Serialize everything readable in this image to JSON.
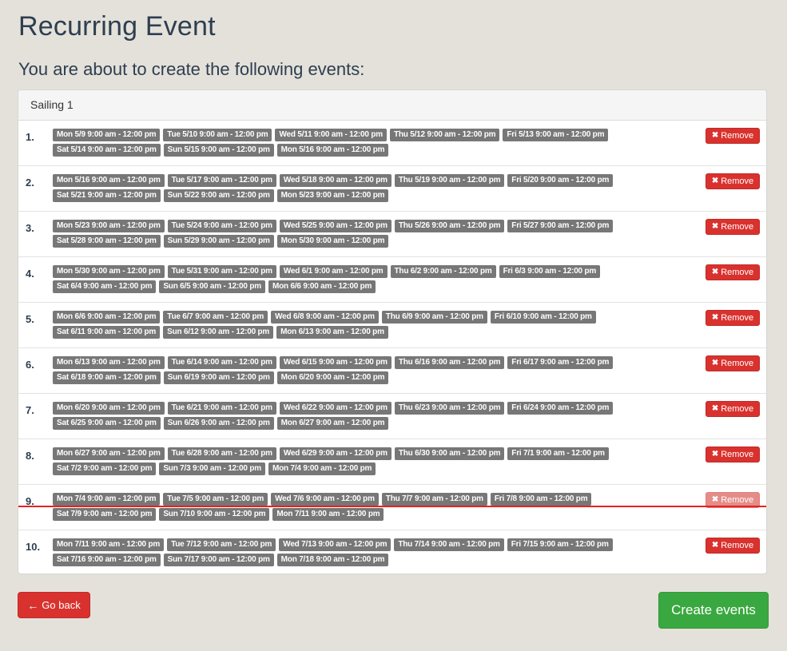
{
  "title": "Recurring Event",
  "subtitle": "You are about to create the following events:",
  "panel": {
    "heading": "Sailing 1"
  },
  "remove_label": "Remove",
  "go_back_label": "Go back",
  "create_label": "Create events",
  "icons": {
    "remove": "close-icon",
    "back": "arrow-left-icon"
  },
  "colors": {
    "tag": "#777777",
    "danger": "#d9322e",
    "success": "#3aa840",
    "highlight_line": "#e8211e"
  },
  "rows": [
    {
      "number": "1.",
      "events": [
        "Mon 5/9 9:00 am - 12:00 pm",
        "Tue 5/10 9:00 am - 12:00 pm",
        "Wed 5/11 9:00 am - 12:00 pm",
        "Thu 5/12 9:00 am - 12:00 pm",
        "Fri 5/13 9:00 am - 12:00 pm",
        "Sat 5/14 9:00 am - 12:00 pm",
        "Sun 5/15 9:00 am - 12:00 pm",
        "Mon 5/16 9:00 am - 12:00 pm"
      ]
    },
    {
      "number": "2.",
      "events": [
        "Mon 5/16 9:00 am - 12:00 pm",
        "Tue 5/17 9:00 am - 12:00 pm",
        "Wed 5/18 9:00 am - 12:00 pm",
        "Thu 5/19 9:00 am - 12:00 pm",
        "Fri 5/20 9:00 am - 12:00 pm",
        "Sat 5/21 9:00 am - 12:00 pm",
        "Sun 5/22 9:00 am - 12:00 pm",
        "Mon 5/23 9:00 am - 12:00 pm"
      ]
    },
    {
      "number": "3.",
      "events": [
        "Mon 5/23 9:00 am - 12:00 pm",
        "Tue 5/24 9:00 am - 12:00 pm",
        "Wed 5/25 9:00 am - 12:00 pm",
        "Thu 5/26 9:00 am - 12:00 pm",
        "Fri 5/27 9:00 am - 12:00 pm",
        "Sat 5/28 9:00 am - 12:00 pm",
        "Sun 5/29 9:00 am - 12:00 pm",
        "Mon 5/30 9:00 am - 12:00 pm"
      ]
    },
    {
      "number": "4.",
      "events": [
        "Mon 5/30 9:00 am - 12:00 pm",
        "Tue 5/31 9:00 am - 12:00 pm",
        "Wed 6/1 9:00 am - 12:00 pm",
        "Thu 6/2 9:00 am - 12:00 pm",
        "Fri 6/3 9:00 am - 12:00 pm",
        "Sat 6/4 9:00 am - 12:00 pm",
        "Sun 6/5 9:00 am - 12:00 pm",
        "Mon 6/6 9:00 am - 12:00 pm"
      ]
    },
    {
      "number": "5.",
      "events": [
        "Mon 6/6 9:00 am - 12:00 pm",
        "Tue 6/7 9:00 am - 12:00 pm",
        "Wed 6/8 9:00 am - 12:00 pm",
        "Thu 6/9 9:00 am - 12:00 pm",
        "Fri 6/10 9:00 am - 12:00 pm",
        "Sat 6/11 9:00 am - 12:00 pm",
        "Sun 6/12 9:00 am - 12:00 pm",
        "Mon 6/13 9:00 am - 12:00 pm"
      ]
    },
    {
      "number": "6.",
      "events": [
        "Mon 6/13 9:00 am - 12:00 pm",
        "Tue 6/14 9:00 am - 12:00 pm",
        "Wed 6/15 9:00 am - 12:00 pm",
        "Thu 6/16 9:00 am - 12:00 pm",
        "Fri 6/17 9:00 am - 12:00 pm",
        "Sat 6/18 9:00 am - 12:00 pm",
        "Sun 6/19 9:00 am - 12:00 pm",
        "Mon 6/20 9:00 am - 12:00 pm"
      ]
    },
    {
      "number": "7.",
      "events": [
        "Mon 6/20 9:00 am - 12:00 pm",
        "Tue 6/21 9:00 am - 12:00 pm",
        "Wed 6/22 9:00 am - 12:00 pm",
        "Thu 6/23 9:00 am - 12:00 pm",
        "Fri 6/24 9:00 am - 12:00 pm",
        "Sat 6/25 9:00 am - 12:00 pm",
        "Sun 6/26 9:00 am - 12:00 pm",
        "Mon 6/27 9:00 am - 12:00 pm"
      ]
    },
    {
      "number": "8.",
      "events": [
        "Mon 6/27 9:00 am - 12:00 pm",
        "Tue 6/28 9:00 am - 12:00 pm",
        "Wed 6/29 9:00 am - 12:00 pm",
        "Thu 6/30 9:00 am - 12:00 pm",
        "Fri 7/1 9:00 am - 12:00 pm",
        "Sat 7/2 9:00 am - 12:00 pm",
        "Sun 7/3 9:00 am - 12:00 pm",
        "Mon 7/4 9:00 am - 12:00 pm"
      ]
    },
    {
      "number": "9.",
      "faded": true,
      "highlighted": true,
      "events": [
        "Mon 7/4 9:00 am - 12:00 pm",
        "Tue 7/5 9:00 am - 12:00 pm",
        "Wed 7/6 9:00 am - 12:00 pm",
        "Thu 7/7 9:00 am - 12:00 pm",
        "Fri 7/8 9:00 am - 12:00 pm",
        "Sat 7/9 9:00 am - 12:00 pm",
        "Sun 7/10 9:00 am - 12:00 pm",
        "Mon 7/11 9:00 am - 12:00 pm"
      ]
    },
    {
      "number": "10.",
      "events": [
        "Mon 7/11 9:00 am - 12:00 pm",
        "Tue 7/12 9:00 am - 12:00 pm",
        "Wed 7/13 9:00 am - 12:00 pm",
        "Thu 7/14 9:00 am - 12:00 pm",
        "Fri 7/15 9:00 am - 12:00 pm",
        "Sat 7/16 9:00 am - 12:00 pm",
        "Sun 7/17 9:00 am - 12:00 pm",
        "Mon 7/18 9:00 am - 12:00 pm"
      ]
    }
  ]
}
